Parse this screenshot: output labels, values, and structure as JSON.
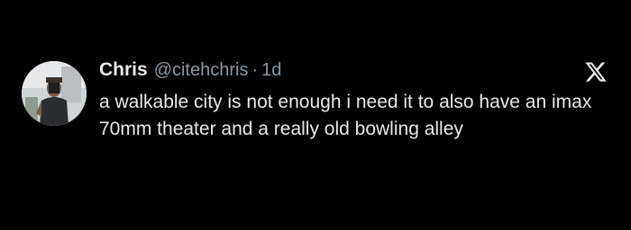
{
  "tweet": {
    "display_name": "Chris",
    "handle": "@citehchris",
    "separator": "·",
    "time": "1d",
    "text": "a walkable city is not enough i need it to also have an imax 70mm theater and a really old bowling alley"
  },
  "icons": {
    "avatar": "profile-photo",
    "platform": "x-logo-icon"
  },
  "colors": {
    "background": "#000000",
    "primary_text": "#e7e9ea",
    "secondary_text": "#8b98a5"
  }
}
